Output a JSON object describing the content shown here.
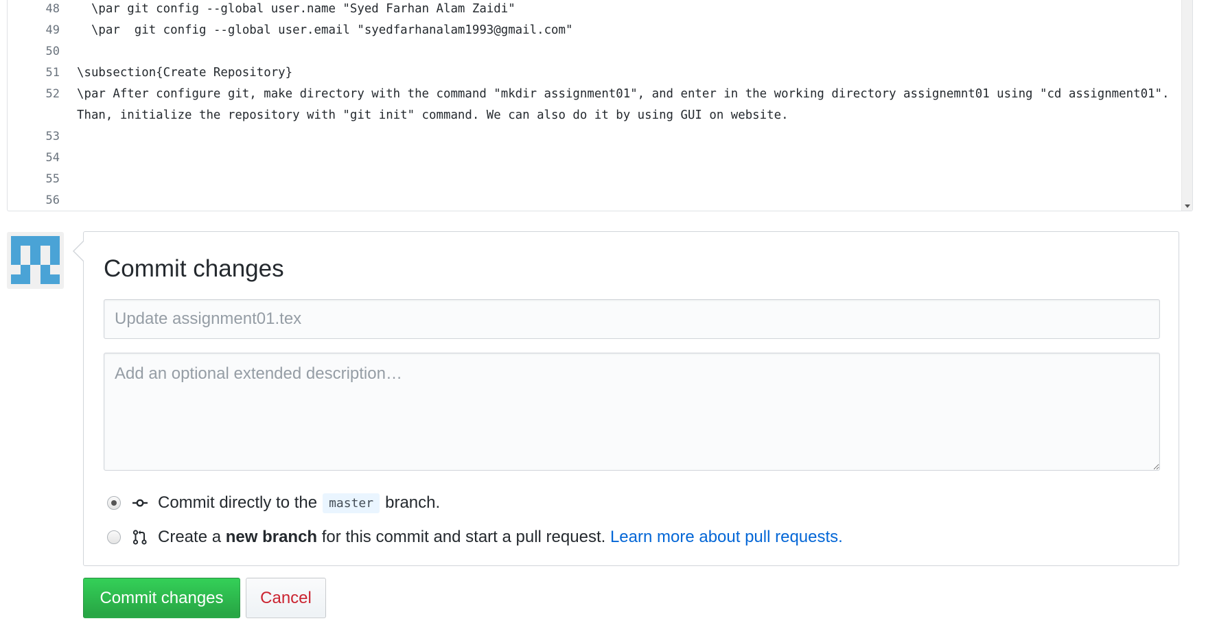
{
  "editor": {
    "lines": [
      {
        "num": "48",
        "text": "  \\par git config --global user.name \"Syed Farhan Alam Zaidi\""
      },
      {
        "num": "49",
        "text": "  \\par  git config --global user.email \"syedfarhanalam1993@gmail.com\""
      },
      {
        "num": "50",
        "text": ""
      },
      {
        "num": "51",
        "text": "\\subsection{Create Repository}"
      },
      {
        "num": "52",
        "text": "\\par After configure git, make directory with the command \"mkdir assignment01\", and enter in the working directory assignemnt01 using \"cd assignment01\". Than, initialize the repository with \"git init\" command. We can also do it by using GUI on website."
      },
      {
        "num": "53",
        "text": ""
      },
      {
        "num": "54",
        "text": ""
      },
      {
        "num": "55",
        "text": ""
      },
      {
        "num": "56",
        "text": ""
      }
    ]
  },
  "commit": {
    "title": "Commit changes",
    "summary_placeholder": "Update assignment01.tex",
    "summary_value": "",
    "description_placeholder": "Add an optional extended description…",
    "description_value": "",
    "option_direct": {
      "before": "Commit directly to the",
      "branch": "master",
      "after": "branch.",
      "selected": true
    },
    "option_new": {
      "before": "Create a",
      "bold": "new branch",
      "after": "for this commit and start a pull request.",
      "link": "Learn more about pull requests.",
      "selected": false
    }
  },
  "buttons": {
    "commit_label": "Commit changes",
    "cancel_label": "Cancel"
  },
  "colors": {
    "primary": "#28a745",
    "danger": "#cb2431",
    "link": "#0366d6",
    "avatar": "#4aa3d6"
  },
  "icons": {
    "commit": "git-commit-icon",
    "pull_request": "git-pull-request-icon",
    "avatar": "identicon-avatar"
  }
}
